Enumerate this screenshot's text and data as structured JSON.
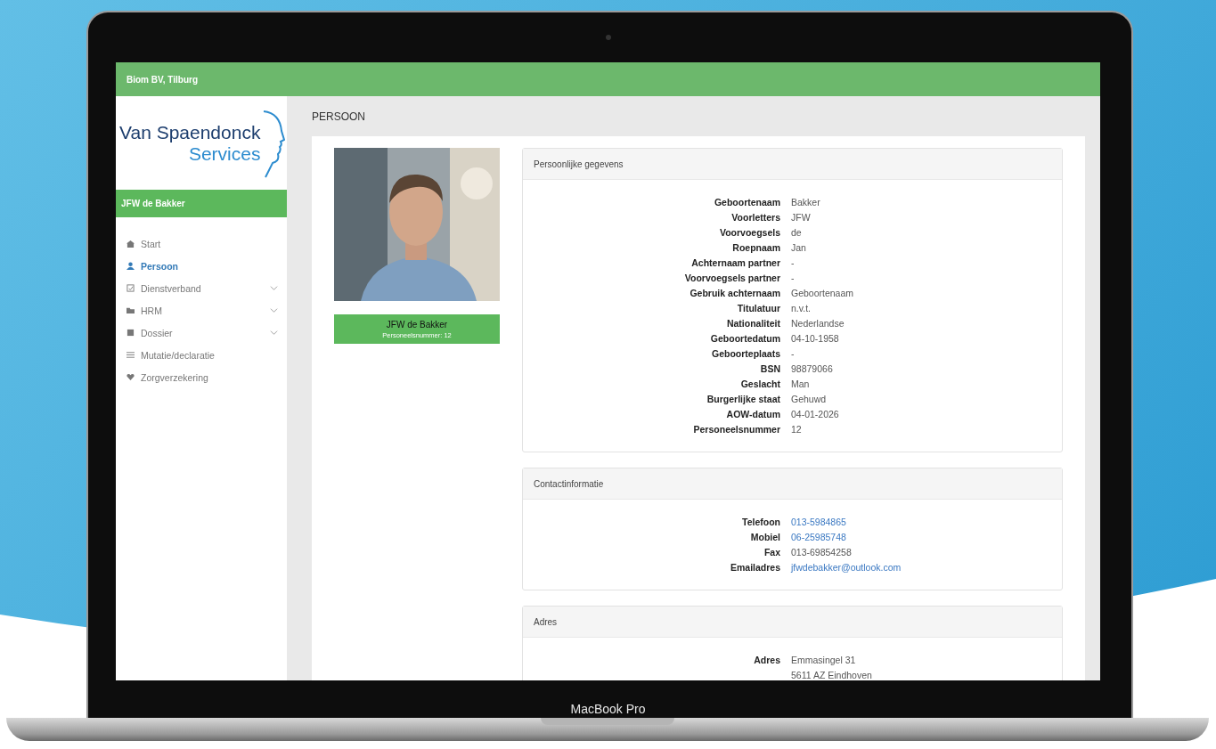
{
  "laptop": {
    "label": "MacBook Pro"
  },
  "top_bar": {
    "title": "Biom BV, Tilburg"
  },
  "sidebar": {
    "logo": {
      "line1": "Van Spaendonck",
      "line2": "Services"
    },
    "user": "JFW de Bakker",
    "items": [
      {
        "label": "Start",
        "selected": false,
        "expandable": false
      },
      {
        "label": "Persoon",
        "selected": true,
        "expandable": false
      },
      {
        "label": "Dienstverband",
        "selected": false,
        "expandable": true
      },
      {
        "label": "HRM",
        "selected": false,
        "expandable": true
      },
      {
        "label": "Dossier",
        "selected": false,
        "expandable": true
      },
      {
        "label": "Mutatie/declaratie",
        "selected": false,
        "expandable": false
      },
      {
        "label": "Zorgverzekering",
        "selected": false,
        "expandable": false
      }
    ]
  },
  "page": {
    "title": "PERSOON",
    "profile": {
      "name": "JFW de Bakker",
      "number": "Personeelsnummer: 12"
    },
    "cards": [
      {
        "title": "Persoonlijke gegevens",
        "rows": [
          {
            "label": "Geboortenaam",
            "value": [
              "Bakker"
            ],
            "link": false
          },
          {
            "label": "Voorletters",
            "value": [
              "JFW"
            ],
            "link": false
          },
          {
            "label": "Voorvoegsels",
            "value": [
              "de"
            ],
            "link": false
          },
          {
            "label": "Roepnaam",
            "value": [
              "Jan"
            ],
            "link": false
          },
          {
            "label": "Achternaam partner",
            "value": [
              "-"
            ],
            "link": false
          },
          {
            "label": "Voorvoegsels partner",
            "value": [
              "-"
            ],
            "link": false
          },
          {
            "label": "Gebruik achternaam",
            "value": [
              "Geboortenaam"
            ],
            "link": false
          },
          {
            "label": "Titulatuur",
            "value": [
              "n.v.t."
            ],
            "link": false
          },
          {
            "label": "Nationaliteit",
            "value": [
              "Nederlandse"
            ],
            "link": false
          },
          {
            "label": "Geboortedatum",
            "value": [
              "04-10-1958"
            ],
            "link": false
          },
          {
            "label": "Geboorteplaats",
            "value": [
              "-"
            ],
            "link": false
          },
          {
            "label": "BSN",
            "value": [
              "98879066"
            ],
            "link": false
          },
          {
            "label": "Geslacht",
            "value": [
              "Man"
            ],
            "link": false
          },
          {
            "label": "Burgerlijke staat",
            "value": [
              "Gehuwd"
            ],
            "link": false
          },
          {
            "label": "AOW-datum",
            "value": [
              "04-01-2026"
            ],
            "link": false
          },
          {
            "label": "Personeelsnummer",
            "value": [
              "12"
            ],
            "link": false
          }
        ]
      },
      {
        "title": "Contactinformatie",
        "rows": [
          {
            "label": "Telefoon",
            "value": [
              "013-5984865"
            ],
            "link": true
          },
          {
            "label": "Mobiel",
            "value": [
              "06-25985748"
            ],
            "link": true
          },
          {
            "label": "Fax",
            "value": [
              "013-69854258"
            ],
            "link": false
          },
          {
            "label": "Emailadres",
            "value": [
              "jfwdebakker@outlook.com"
            ],
            "link": true
          }
        ]
      },
      {
        "title": "Adres",
        "rows": [
          {
            "label": "Adres",
            "value": [
              "Emmasingel 31",
              "5611 AZ Eindhoven"
            ],
            "link": false
          }
        ]
      }
    ]
  }
}
